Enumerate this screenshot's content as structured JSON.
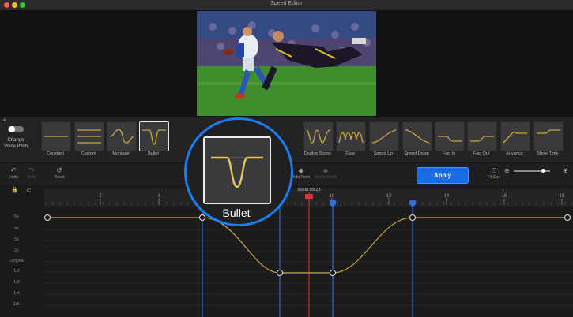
{
  "window": {
    "title": "Speed Editor"
  },
  "change_voice_pitch": {
    "label_line1": "Change",
    "label_line2": "Voice Pitch",
    "enabled": false
  },
  "presets": [
    {
      "label": "Constant",
      "shape": "flat",
      "selected": false
    },
    {
      "label": "Custom",
      "shape": "sliders",
      "selected": false
    },
    {
      "label": "Montage",
      "shape": "wave",
      "selected": false
    },
    {
      "label": "Bullet",
      "shape": "dip",
      "selected": true
    },
    {
      "label": "Double Slomo",
      "shape": "double",
      "selected": false
    },
    {
      "label": "Flow",
      "shape": "flow",
      "selected": false
    },
    {
      "label": "Speed Up",
      "shape": "up",
      "selected": false
    },
    {
      "label": "Speed Down",
      "shape": "down",
      "selected": false
    },
    {
      "label": "Fast In",
      "shape": "fastin",
      "selected": false
    },
    {
      "label": "Fast Out",
      "shape": "fastout",
      "selected": false
    },
    {
      "label": "Advance",
      "shape": "advance",
      "selected": false
    },
    {
      "label": "Show Time",
      "shape": "showtime",
      "selected": false
    }
  ],
  "toolbar": {
    "undo": "Undo",
    "redo": "Redo",
    "reset": "Reset",
    "add_point": "Add Point",
    "delete_point": "Delete Point",
    "apply": "Apply",
    "fit_size": "Fit Size",
    "zoom_level": 0.82
  },
  "ruler": {
    "ticks": [
      "2",
      "4",
      "6",
      "8",
      "10",
      "12",
      "14",
      "16",
      "18"
    ],
    "playhead_time": "00:00:09.23"
  },
  "speed_labels": [
    "5x",
    "4x",
    "3x",
    "2x",
    "Origina",
    "1/2",
    "1/3",
    "1/4",
    "1/5"
  ],
  "zoom_callout": {
    "label": "Bullet"
  },
  "colors": {
    "accent": "#1a6be6",
    "curve": "#c9a640",
    "playhead": "#e03030",
    "marker": "#2f6fe0"
  }
}
